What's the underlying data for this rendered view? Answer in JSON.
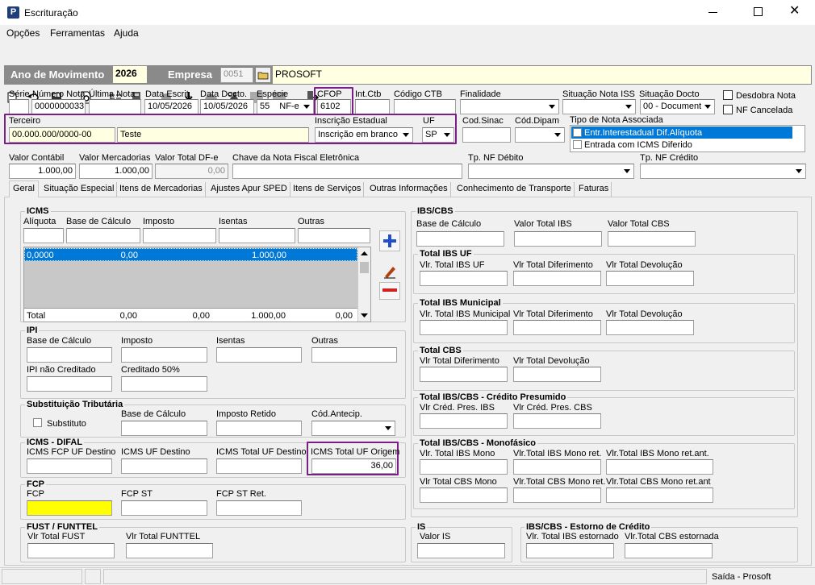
{
  "window": {
    "title": "Escrituração"
  },
  "menu": [
    "Opções",
    "Ferramentas",
    "Ajuda"
  ],
  "header": {
    "ano_label": "Ano de Movimento",
    "ano": "2026",
    "empresa_label": "Empresa",
    "empresa_code": "0051",
    "empresa_name": "PROSOFT"
  },
  "row1": {
    "serie_label": "Série",
    "serie": "",
    "numero_label": "Número Nota",
    "numero": "0000000033",
    "ultima_label": "Última Nota",
    "ultima": "",
    "data_escrit_label": "Data Escrit.",
    "data_escrit": "10/05/2026",
    "data_docto_label": "Data Docto.",
    "data_docto": "10/05/2026",
    "especie_label": "Espécie",
    "especie_code": "55",
    "especie": "NF-e",
    "cfop_label": "CFOP",
    "cfop": "6102",
    "intctb_label": "Int.Ctb",
    "intctb": "",
    "codctb_label": "Código CTB",
    "codctb": "",
    "finalidade_label": "Finalidade",
    "finalidade": "",
    "sitiss_label": "Situação Nota ISS",
    "sitiss": "",
    "sitdocto_label": "Situação Docto",
    "sitdocto": "00 - Document",
    "desdobra_label": "Desdobra Nota",
    "cancelada_label": "NF Cancelada"
  },
  "row2": {
    "terceiro_label": "Terceiro",
    "terceiro_cnpj": "00.000.000/0000-00",
    "terceiro_nome": "Teste",
    "ie_label": "Inscrição Estadual",
    "ie": "Inscrição em branco",
    "uf_label": "UF",
    "uf": "SP",
    "codsinac_label": "Cod.Sinac",
    "coddipam_label": "Cód.Dipam",
    "tipo_label": "Tipo de Nota Associada",
    "tipo_items": [
      "Entr.Interestadual Dif.Alíquota",
      "Entrada com ICMS Diferido"
    ]
  },
  "row3": {
    "valor_contabil_label": "Valor Contábil",
    "valor_contabil": "1.000,00",
    "valor_merc_label": "Valor Mercadorias",
    "valor_merc": "1.000,00",
    "valor_dfe_label": "Valor Total DF-e",
    "valor_dfe": "0,00",
    "chave_label": "Chave da Nota Fiscal Eletrônica",
    "tpdeb_label": "Tp. NF Débito",
    "tpcred_label": "Tp. NF Crédito"
  },
  "tabs": [
    "Geral",
    "Situação Especial",
    "Itens de Mercadorias",
    "Ajustes Apur SPED",
    "Itens de Serviços",
    "Outras Informações",
    "Conhecimento de Transporte",
    "Faturas"
  ],
  "icms": {
    "title": "ICMS",
    "cols": [
      "Alíquota",
      "Base de Cálculo",
      "Imposto",
      "Isentas",
      "Outras"
    ],
    "row": [
      "0,0000",
      "0,00",
      "",
      "1.000,00",
      ""
    ],
    "total_label": "Total",
    "totals": [
      "0,00",
      "0,00",
      "1.000,00",
      "0,00"
    ]
  },
  "ipi": {
    "title": "IPI",
    "base": "Base de Cálculo",
    "imposto": "Imposto",
    "isentas": "Isentas",
    "outras": "Outras",
    "naocred": "IPI não Creditado",
    "cred50": "Creditado 50%"
  },
  "st": {
    "title": "Substituição Tributária",
    "substituto": "Substituto",
    "base": "Base de Cálculo",
    "retido": "Imposto Retido",
    "codantecip": "Cód.Antecip."
  },
  "difal": {
    "title": "ICMS - DIFAL",
    "fcp": "ICMS FCP UF Destino",
    "ufdest": "ICMS UF Destino",
    "totaldest": "ICMS Total UF Destino",
    "totalorig": "ICMS Total UF Origem",
    "totalorig_value": "36,00"
  },
  "fcp": {
    "title": "FCP",
    "fcp": "FCP",
    "fcpst": "FCP ST",
    "fcpstret": "FCP ST Ret."
  },
  "fust": {
    "title": "FUST / FUNTTEL",
    "fust": "Vlr Total FUST",
    "funttel": "Vlr Total FUNTTEL"
  },
  "ibs": {
    "title": "IBS/CBS",
    "base": "Base de Cálculo",
    "vibs": "Valor Total IBS",
    "vcbs": "Valor Total CBS",
    "uf_title": "Total IBS UF",
    "uf1": "Vlr. Total IBS UF",
    "uf2": "Vlr Total Diferimento",
    "uf3": "Vlr Total Devolução",
    "mun_title": "Total IBS Municipal",
    "mun1": "Vlr. Total IBS Municipal",
    "mun2": "Vlr Total Diferimento",
    "mun3": "Vlr Total Devolução",
    "cbs_title": "Total CBS",
    "cbs1": "Vlr Total Diferimento",
    "cbs2": "Vlr Total Devolução",
    "cp_title": "Total IBS/CBS - Crédito Presumido",
    "cp1": "Vlr Créd. Pres. IBS",
    "cp2": "Vlr Créd. Pres. CBS",
    "mono_title": "Total IBS/CBS - Monofásico",
    "mono1": "Vlr. Total IBS Mono",
    "mono2": "Vlr.Total IBS Mono ret.",
    "mono3": "Vlr.Total IBS Mono ret.ant.",
    "mono4": "Vlr Total CBS Mono",
    "mono5": "Vlr.Total CBS Mono ret.",
    "mono6": "Vlr.Total CBS Mono ret.ant"
  },
  "is": {
    "title": "IS",
    "valor": "Valor IS"
  },
  "estorno": {
    "title": "IBS/CBS - Estorno de Crédito",
    "ibs": "Vlr. Total IBS estornado",
    "cbs": "Vlr.Total CBS estornada"
  },
  "status": {
    "text": "Saída - Prosoft"
  }
}
